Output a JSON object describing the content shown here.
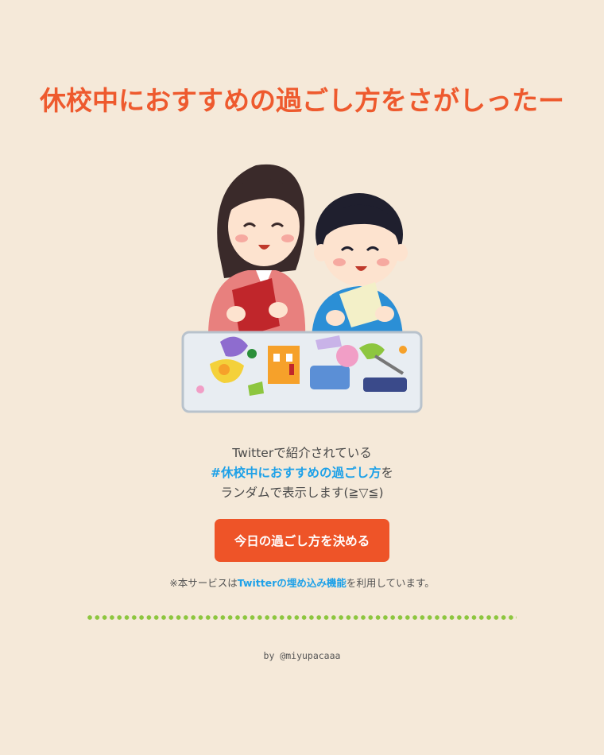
{
  "header": {
    "title": "休校中におすすめの過ごし方をさがしったー"
  },
  "illustration": {
    "icon": "family-craft-illustration"
  },
  "description": {
    "line1": "Twitterで紹介されている",
    "hashtag": "#休校中におすすめの過ごし方",
    "hashtag_suffix": "を",
    "line3": "ランダムで表示します(≧▽≦)"
  },
  "cta": {
    "label": "今日の過ごし方を決める"
  },
  "note": {
    "prefix": "※本サービスは",
    "link": "Twitterの埋め込み機能",
    "suffix": "を利用しています。"
  },
  "footer": {
    "by": "by ",
    "author": "@miyupacaaa"
  },
  "colors": {
    "background": "#f5e9d9",
    "accent": "#ee5428",
    "link": "#1ea1e8",
    "divider": "#8dc63f"
  }
}
